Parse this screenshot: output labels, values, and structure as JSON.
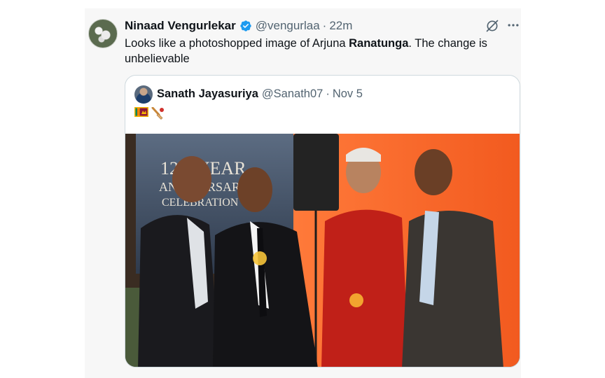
{
  "tweet": {
    "author_name": "Ninaad Vengurlekar",
    "handle": "@vengurlaa",
    "separator": "·",
    "time": "22m",
    "text_before": "Looks like a photoshopped image of Arjuna ",
    "text_bold": "Ranatunga",
    "text_after": ". The change is unbelievable",
    "verified_color": "#1d9bf0"
  },
  "quote": {
    "author_name": "Sanath Jayasuriya",
    "handle": "@Sanath07",
    "separator": "·",
    "date": "Nov 5",
    "emojis": [
      "sri-lanka-flag-icon",
      "cricket-bat-icon"
    ],
    "photo": {
      "banner_text_line1": "12th YEAR",
      "banner_text_line2": "ANNIVERSARY",
      "banner_text_line3": "CELEBRATION"
    }
  },
  "colors": {
    "text": "#0f1419",
    "muted": "#536471",
    "border": "#cfd9de",
    "accent": "#1d9bf0"
  }
}
